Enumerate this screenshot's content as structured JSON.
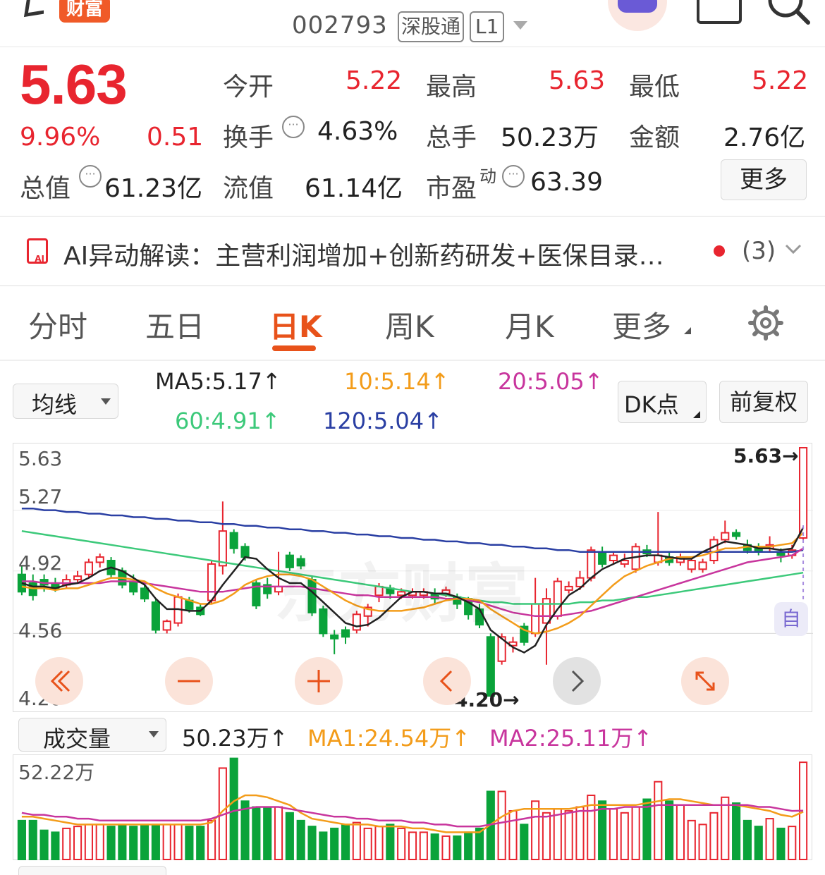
{
  "header": {
    "brand_badge": "财富",
    "stock_code": "002793",
    "tag_connect": "深股通",
    "tag_level": "L1"
  },
  "quote": {
    "price": "5.63",
    "change_pct": "9.96%",
    "change_amt": "0.51",
    "open_label": "今开",
    "open_value": "5.22",
    "high_label": "最高",
    "high_value": "5.63",
    "low_label": "最低",
    "low_value": "5.22",
    "turnover_label": "换手",
    "turnover_value": "4.63%",
    "volume_label": "总手",
    "volume_value": "50.23万",
    "amount_label": "金额",
    "amount_value": "2.76亿",
    "mktcap_label": "总值",
    "mktcap_value": "61.23亿",
    "float_label": "流值",
    "float_value": "61.14亿",
    "pe_label": "市盈",
    "pe_sup": "动",
    "pe_value": "63.39",
    "more_button": "更多"
  },
  "ai_bar": {
    "text": "AI异动解读：主营利润增加+创新药研发+医保目录…",
    "count": "(3)"
  },
  "tabs": [
    "分时",
    "五日",
    "日K",
    "周K",
    "月K",
    "更多"
  ],
  "active_tab": "日K",
  "ma_bar": {
    "selector": "均线",
    "ma5": "MA5:5.17↑",
    "ma10": "10:5.14↑",
    "ma20": "20:5.05↑",
    "ma60": "60:4.91↑",
    "ma120": "120:5.04↑",
    "dk_button": "DK点",
    "adjust_button": "前复权",
    "colors": {
      "ma5": "#222222",
      "ma10": "#f39c1a",
      "ma20": "#c8359d",
      "ma60": "#3cc97a",
      "ma120": "#2a3fa3"
    }
  },
  "price_axis": [
    "5.63",
    "5.27",
    "4.92",
    "4.56",
    "4.20"
  ],
  "price_marks": {
    "high_label": "5.63→",
    "low_label": "4.20→",
    "auto_label": "自"
  },
  "volume_bar": {
    "selector": "成交量",
    "current": "50.23万↑",
    "ma1": "MA1:24.54万↑",
    "ma2": "MA2:25.11万↑",
    "axis_max": "52.22万"
  },
  "colors": {
    "up": "#e8252f",
    "down": "#0aa33a",
    "accent": "#e8521a"
  },
  "chart_data": [
    {
      "type": "candlestick",
      "ylim": [
        4.2,
        5.63
      ],
      "candles": [
        {
          "o": 4.9,
          "c": 4.8,
          "h": 4.95,
          "l": 4.78
        },
        {
          "o": 4.85,
          "c": 4.78,
          "h": 4.9,
          "l": 4.75
        },
        {
          "o": 4.87,
          "c": 4.84,
          "h": 4.9,
          "l": 4.8
        },
        {
          "o": 4.85,
          "c": 4.82,
          "h": 4.88,
          "l": 4.8
        },
        {
          "o": 4.84,
          "c": 4.87,
          "h": 4.9,
          "l": 4.82
        },
        {
          "o": 4.87,
          "c": 4.89,
          "h": 4.92,
          "l": 4.85
        },
        {
          "o": 4.9,
          "c": 4.97,
          "h": 4.99,
          "l": 4.88
        },
        {
          "o": 4.97,
          "c": 5.0,
          "h": 5.02,
          "l": 4.94
        },
        {
          "o": 4.98,
          "c": 4.9,
          "h": 5.0,
          "l": 4.88
        },
        {
          "o": 4.92,
          "c": 4.84,
          "h": 4.94,
          "l": 4.82
        },
        {
          "o": 4.86,
          "c": 4.8,
          "h": 4.9,
          "l": 4.78
        },
        {
          "o": 4.82,
          "c": 4.76,
          "h": 4.84,
          "l": 4.74
        },
        {
          "o": 4.74,
          "c": 4.58,
          "h": 4.76,
          "l": 4.56
        },
        {
          "o": 4.58,
          "c": 4.63,
          "h": 4.64,
          "l": 4.56
        },
        {
          "o": 4.62,
          "c": 4.77,
          "h": 4.79,
          "l": 4.6
        },
        {
          "o": 4.75,
          "c": 4.7,
          "h": 4.77,
          "l": 4.68
        },
        {
          "o": 4.71,
          "c": 4.67,
          "h": 4.73,
          "l": 4.66
        },
        {
          "o": 4.75,
          "c": 4.96,
          "h": 4.98,
          "l": 4.73
        },
        {
          "o": 4.95,
          "c": 5.15,
          "h": 5.32,
          "l": 4.9
        },
        {
          "o": 5.14,
          "c": 5.05,
          "h": 5.16,
          "l": 5.02
        },
        {
          "o": 5.06,
          "c": 5.0,
          "h": 5.08,
          "l": 4.98
        },
        {
          "o": 4.85,
          "c": 4.72,
          "h": 4.87,
          "l": 4.7
        },
        {
          "o": 4.84,
          "c": 4.79,
          "h": 4.88,
          "l": 4.76
        },
        {
          "o": 4.8,
          "c": 4.83,
          "h": 5.03,
          "l": 4.78
        },
        {
          "o": 5.01,
          "c": 4.94,
          "h": 5.03,
          "l": 4.92
        },
        {
          "o": 4.99,
          "c": 4.95,
          "h": 5.01,
          "l": 4.93
        },
        {
          "o": 4.87,
          "c": 4.68,
          "h": 4.89,
          "l": 4.66
        },
        {
          "o": 4.7,
          "c": 4.56,
          "h": 4.72,
          "l": 4.54
        },
        {
          "o": 4.55,
          "c": 4.53,
          "h": 4.58,
          "l": 4.44
        },
        {
          "o": 4.58,
          "c": 4.54,
          "h": 4.6,
          "l": 4.5
        },
        {
          "o": 4.58,
          "c": 4.67,
          "h": 4.69,
          "l": 4.56
        },
        {
          "o": 4.66,
          "c": 4.71,
          "h": 4.73,
          "l": 4.6
        },
        {
          "o": 4.78,
          "c": 4.83,
          "h": 4.85,
          "l": 4.74
        },
        {
          "o": 4.82,
          "c": 4.79,
          "h": 4.84,
          "l": 4.76
        },
        {
          "o": 4.78,
          "c": 4.8,
          "h": 4.82,
          "l": 4.76
        },
        {
          "o": 4.78,
          "c": 4.8,
          "h": 4.82,
          "l": 4.76
        },
        {
          "o": 4.78,
          "c": 4.8,
          "h": 4.82,
          "l": 4.76
        },
        {
          "o": 4.79,
          "c": 4.76,
          "h": 4.82,
          "l": 4.73
        },
        {
          "o": 4.79,
          "c": 4.81,
          "h": 4.83,
          "l": 4.77
        },
        {
          "o": 4.77,
          "c": 4.73,
          "h": 4.79,
          "l": 4.7
        },
        {
          "o": 4.76,
          "c": 4.67,
          "h": 4.77,
          "l": 4.64
        },
        {
          "o": 4.7,
          "c": 4.61,
          "h": 4.73,
          "l": 4.59
        },
        {
          "o": 4.54,
          "c": 4.2,
          "h": 4.56,
          "l": 4.2
        },
        {
          "o": 4.4,
          "c": 4.54,
          "h": 4.56,
          "l": 4.38
        },
        {
          "o": 4.49,
          "c": 4.51,
          "h": 4.54,
          "l": 4.45
        },
        {
          "o": 4.6,
          "c": 4.51,
          "h": 4.62,
          "l": 4.49
        },
        {
          "o": 4.56,
          "c": 4.73,
          "h": 4.88,
          "l": 4.54
        },
        {
          "o": 4.62,
          "c": 4.76,
          "h": 4.82,
          "l": 4.38
        },
        {
          "o": 4.66,
          "c": 4.86,
          "h": 4.88,
          "l": 4.64
        },
        {
          "o": 4.81,
          "c": 4.83,
          "h": 4.86,
          "l": 4.79
        },
        {
          "o": 4.83,
          "c": 4.88,
          "h": 4.92,
          "l": 4.81
        },
        {
          "o": 4.88,
          "c": 5.04,
          "h": 5.06,
          "l": 4.86
        },
        {
          "o": 5.03,
          "c": 4.96,
          "h": 5.06,
          "l": 4.94
        },
        {
          "o": 4.98,
          "c": 5.01,
          "h": 5.03,
          "l": 4.96
        },
        {
          "o": 4.96,
          "c": 4.98,
          "h": 5.02,
          "l": 4.94
        },
        {
          "o": 4.93,
          "c": 5.06,
          "h": 5.08,
          "l": 4.91
        },
        {
          "o": 5.04,
          "c": 5.02,
          "h": 5.07,
          "l": 5.0
        },
        {
          "o": 4.97,
          "c": 5.01,
          "h": 5.26,
          "l": 4.95
        },
        {
          "o": 5.0,
          "c": 4.97,
          "h": 5.03,
          "l": 4.95
        },
        {
          "o": 4.97,
          "c": 5.0,
          "h": 5.02,
          "l": 4.95
        },
        {
          "o": 4.93,
          "c": 4.98,
          "h": 5.0,
          "l": 4.91
        },
        {
          "o": 4.93,
          "c": 4.97,
          "h": 4.99,
          "l": 4.91
        },
        {
          "o": 4.98,
          "c": 5.1,
          "h": 5.12,
          "l": 4.96
        },
        {
          "o": 5.1,
          "c": 5.14,
          "h": 5.21,
          "l": 5.08
        },
        {
          "o": 5.14,
          "c": 5.12,
          "h": 5.16,
          "l": 5.1
        },
        {
          "o": 5.07,
          "c": 5.04,
          "h": 5.1,
          "l": 5.02
        },
        {
          "o": 5.06,
          "c": 5.03,
          "h": 5.08,
          "l": 5.01
        },
        {
          "o": 5.05,
          "c": 5.07,
          "h": 5.12,
          "l": 5.03
        },
        {
          "o": 5.03,
          "c": 5.01,
          "h": 5.05,
          "l": 4.97
        },
        {
          "o": 5.01,
          "c": 5.04,
          "h": 5.07,
          "l": 4.99
        },
        {
          "o": 5.11,
          "c": 5.63,
          "h": 5.63,
          "l": 5.1
        }
      ],
      "ma5": [
        4.85,
        4.83,
        4.83,
        4.82,
        4.84,
        4.85,
        4.88,
        4.92,
        4.94,
        4.92,
        4.88,
        4.84,
        4.76,
        4.7,
        4.7,
        4.69,
        4.69,
        4.75,
        4.84,
        4.92,
        5.0,
        4.99,
        4.93,
        4.88,
        4.85,
        4.85,
        4.8,
        4.74,
        4.68,
        4.62,
        4.6,
        4.61,
        4.65,
        4.71,
        4.77,
        4.8,
        4.8,
        4.79,
        4.79,
        4.77,
        4.74,
        4.7,
        4.58,
        4.53,
        4.48,
        4.45,
        4.49,
        4.61,
        4.7,
        4.78,
        4.82,
        4.88,
        4.93,
        4.96,
        4.99,
        5.0,
        5.01,
        5.01,
        5.0,
        4.99,
        4.99,
        5.03,
        5.06,
        5.09,
        5.08,
        5.07,
        5.05,
        5.05,
        5.04,
        5.05,
        5.17
      ],
      "ma10": [
        4.83,
        4.82,
        4.82,
        4.81,
        4.82,
        4.82,
        4.84,
        4.86,
        4.88,
        4.88,
        4.87,
        4.86,
        4.82,
        4.79,
        4.77,
        4.75,
        4.73,
        4.73,
        4.75,
        4.79,
        4.84,
        4.87,
        4.89,
        4.9,
        4.9,
        4.89,
        4.87,
        4.83,
        4.79,
        4.75,
        4.72,
        4.7,
        4.69,
        4.69,
        4.69,
        4.7,
        4.71,
        4.73,
        4.75,
        4.76,
        4.76,
        4.75,
        4.7,
        4.66,
        4.62,
        4.58,
        4.56,
        4.57,
        4.59,
        4.62,
        4.66,
        4.72,
        4.78,
        4.84,
        4.89,
        4.92,
        4.95,
        4.97,
        4.99,
        5.0,
        5.0,
        5.01,
        5.03,
        5.05,
        5.05,
        5.06,
        5.06,
        5.06,
        5.07,
        5.08,
        5.14
      ],
      "ma20": [
        4.86,
        4.86,
        4.85,
        4.85,
        4.85,
        4.85,
        4.85,
        4.85,
        4.86,
        4.86,
        4.86,
        4.85,
        4.84,
        4.83,
        4.82,
        4.81,
        4.8,
        4.8,
        4.8,
        4.81,
        4.82,
        4.83,
        4.83,
        4.83,
        4.83,
        4.83,
        4.82,
        4.81,
        4.8,
        4.79,
        4.78,
        4.78,
        4.77,
        4.77,
        4.77,
        4.77,
        4.77,
        4.77,
        4.76,
        4.76,
        4.75,
        4.74,
        4.72,
        4.7,
        4.68,
        4.67,
        4.66,
        4.66,
        4.66,
        4.67,
        4.68,
        4.69,
        4.71,
        4.73,
        4.75,
        4.77,
        4.79,
        4.81,
        4.83,
        4.85,
        4.87,
        4.89,
        4.91,
        4.93,
        4.95,
        4.97,
        4.98,
        4.99,
        5.0,
        5.01,
        5.05
      ],
      "ma60": [
        5.15,
        5.14,
        5.13,
        5.12,
        5.11,
        5.1,
        5.09,
        5.08,
        5.07,
        5.06,
        5.05,
        5.04,
        5.03,
        5.02,
        5.01,
        5.0,
        4.99,
        4.98,
        4.97,
        4.96,
        4.95,
        4.94,
        4.93,
        4.92,
        4.91,
        4.9,
        4.89,
        4.88,
        4.87,
        4.86,
        4.85,
        4.84,
        4.83,
        4.82,
        4.81,
        4.8,
        4.8,
        4.79,
        4.78,
        4.77,
        4.76,
        4.75,
        4.74,
        4.74,
        4.73,
        4.73,
        4.73,
        4.73,
        4.73,
        4.73,
        4.74,
        4.74,
        4.75,
        4.75,
        4.76,
        4.77,
        4.77,
        4.78,
        4.79,
        4.8,
        4.81,
        4.82,
        4.83,
        4.84,
        4.85,
        4.86,
        4.87,
        4.88,
        4.89,
        4.9,
        4.91
      ],
      "ma120": [
        5.28,
        5.28,
        5.27,
        5.27,
        5.26,
        5.26,
        5.25,
        5.25,
        5.24,
        5.24,
        5.23,
        5.23,
        5.22,
        5.22,
        5.21,
        5.21,
        5.2,
        5.2,
        5.19,
        5.19,
        5.18,
        5.18,
        5.17,
        5.17,
        5.16,
        5.16,
        5.15,
        5.15,
        5.14,
        5.14,
        5.13,
        5.13,
        5.12,
        5.12,
        5.11,
        5.11,
        5.1,
        5.1,
        5.09,
        5.09,
        5.08,
        5.08,
        5.07,
        5.07,
        5.06,
        5.06,
        5.05,
        5.05,
        5.04,
        5.04,
        5.03,
        5.03,
        5.03,
        5.03,
        5.03,
        5.03,
        5.03,
        5.03,
        5.03,
        5.03,
        5.03,
        5.03,
        5.03,
        5.03,
        5.03,
        5.03,
        5.03,
        5.03,
        5.03,
        5.03,
        5.04
      ]
    },
    {
      "type": "bar",
      "ymax": 52.22,
      "unit": "万",
      "volumes": [
        20,
        20,
        15,
        14,
        16,
        17,
        18,
        18,
        17,
        18,
        17,
        18,
        18,
        18,
        18,
        17,
        17,
        20,
        47,
        52,
        30,
        27,
        27,
        27,
        24,
        20,
        17,
        14,
        16,
        18,
        19,
        16,
        17,
        18,
        16,
        14,
        14,
        13,
        12,
        12,
        14,
        16,
        35,
        35,
        25,
        18,
        30,
        24,
        26,
        25,
        27,
        33,
        30,
        26,
        24,
        27,
        31,
        40,
        30,
        28,
        20,
        18,
        24,
        32,
        29,
        20,
        17,
        21,
        16,
        17,
        50
      ],
      "ma1": [
        22,
        22,
        21,
        20,
        19,
        18,
        18,
        18,
        18,
        18,
        18,
        18,
        18,
        18,
        18,
        18,
        18,
        19,
        25,
        30,
        33,
        33,
        32,
        30,
        28,
        24,
        21,
        20,
        19,
        18,
        18,
        18,
        17,
        17,
        17,
        16,
        16,
        15,
        14,
        14,
        14,
        14,
        18,
        22,
        25,
        26,
        26,
        26,
        26,
        26,
        27,
        28,
        28,
        28,
        28,
        28,
        29,
        30,
        31,
        31,
        30,
        29,
        28,
        28,
        28,
        27,
        26,
        25,
        23,
        22,
        24.54
      ],
      "ma2": [
        24,
        23,
        23,
        22,
        22,
        21,
        21,
        20,
        20,
        20,
        20,
        20,
        20,
        20,
        20,
        20,
        20,
        21,
        23,
        25,
        26,
        27,
        27,
        27,
        26,
        25,
        24,
        23,
        22,
        22,
        21,
        21,
        20,
        20,
        20,
        19,
        19,
        18,
        18,
        17,
        17,
        17,
        18,
        19,
        20,
        21,
        22,
        22,
        23,
        24,
        25,
        25,
        26,
        26,
        27,
        27,
        27,
        28,
        28,
        28,
        28,
        28,
        28,
        28,
        28,
        28,
        27,
        27,
        26,
        25,
        25.11
      ]
    }
  ]
}
